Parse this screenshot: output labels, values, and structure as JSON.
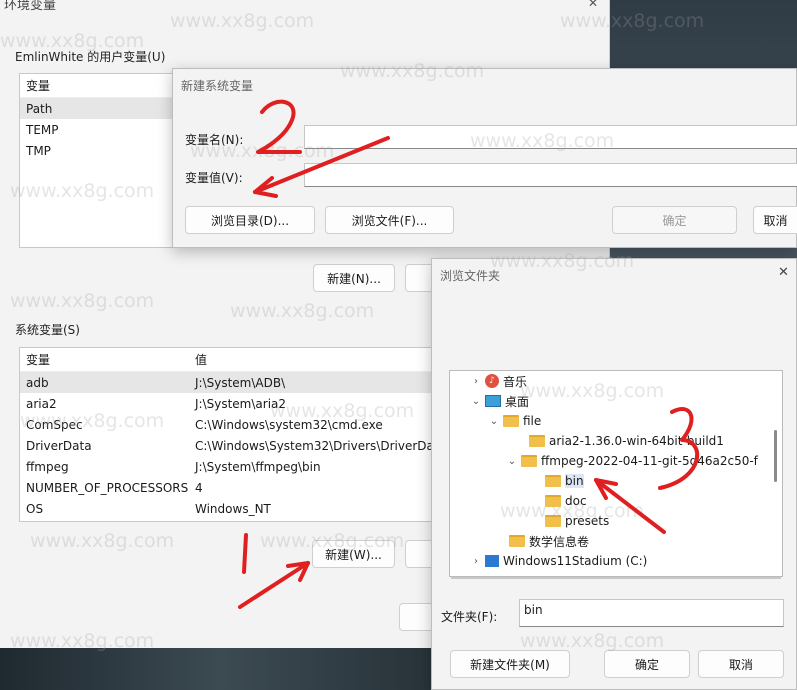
{
  "env_window": {
    "title": "环境变量",
    "user_group_label": "EmlinWhite 的用户变量(U)",
    "user_header": "变量",
    "user_vars": [
      "Path",
      "TEMP",
      "TMP"
    ],
    "user_new_button": "新建(N)...",
    "system_group_label": "系统变量(S)",
    "system_header_name": "变量",
    "system_header_value": "值",
    "system_vars": [
      {
        "name": "adb",
        "value": "J:\\System\\ADB\\"
      },
      {
        "name": "aria2",
        "value": "J:\\System\\aria2"
      },
      {
        "name": "ComSpec",
        "value": "C:\\Windows\\system32\\cmd.exe"
      },
      {
        "name": "DriverData",
        "value": "C:\\Windows\\System32\\Drivers\\DriverDat"
      },
      {
        "name": "ffmpeg",
        "value": "J:\\System\\ffmpeg\\bin"
      },
      {
        "name": "NUMBER_OF_PROCESSORS",
        "value": "4"
      },
      {
        "name": "OS",
        "value": "Windows_NT"
      }
    ],
    "system_new_button": "新建(W)..."
  },
  "new_var_dialog": {
    "title": "新建系统变量",
    "name_label": "变量名(N):",
    "value_label": "变量值(V):",
    "browse_dir_button": "浏览目录(D)...",
    "browse_file_button": "浏览文件(F)...",
    "ok_button": "确定",
    "cancel_button": "取消"
  },
  "browse_dialog": {
    "title": "浏览文件夹",
    "tree": {
      "music": "音乐",
      "desktop": "桌面",
      "file": "file",
      "aria2": "aria2-1.36.0-win-64bit-build1",
      "ffmpeg": "ffmpeg-2022-04-11-git-5d46a2c50-f",
      "bin": "bin",
      "doc": "doc",
      "presets": "presets",
      "math": "数学信息卷",
      "drive": "Windows11Stadium (C:)"
    },
    "folder_label": "文件夹(F):",
    "folder_value": "bin",
    "new_folder_button": "新建文件夹(M)",
    "ok_button": "确定",
    "cancel_button": "取消"
  },
  "annotations": [
    "1",
    "2",
    "3"
  ],
  "watermark": "www.xx8g.com"
}
